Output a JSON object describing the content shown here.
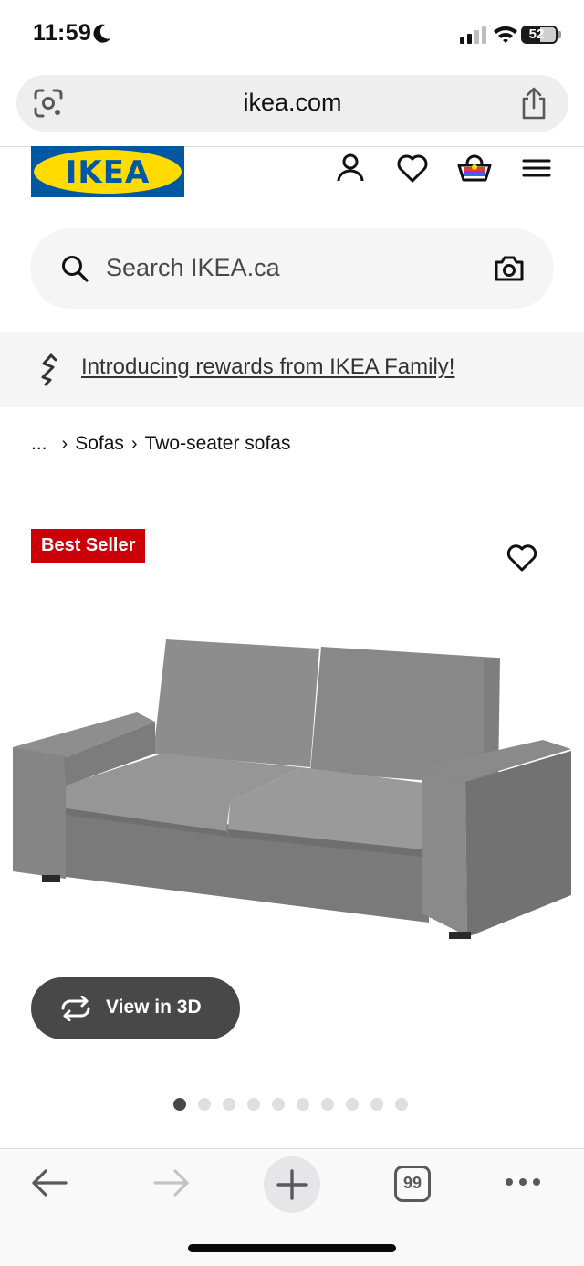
{
  "status_bar": {
    "time": "11:59",
    "battery": "52"
  },
  "browser": {
    "url": "ikea.com",
    "tab_count": "99"
  },
  "header": {
    "logo_text": "IKEA",
    "brand_colors": {
      "blue": "#0058a3",
      "yellow": "#ffdb00"
    }
  },
  "search": {
    "placeholder": "Search IKEA.ca"
  },
  "banner": {
    "link_text": "Introducing rewards from IKEA Family!"
  },
  "breadcrumb": {
    "ellipsis": "...",
    "items": [
      "Sofas",
      "Two-seater sofas"
    ]
  },
  "product": {
    "badge": "Best Seller",
    "badge_color": "#cc0008",
    "view_3d_label": "View in 3D",
    "carousel": {
      "total": 10,
      "active_index": 0
    }
  }
}
